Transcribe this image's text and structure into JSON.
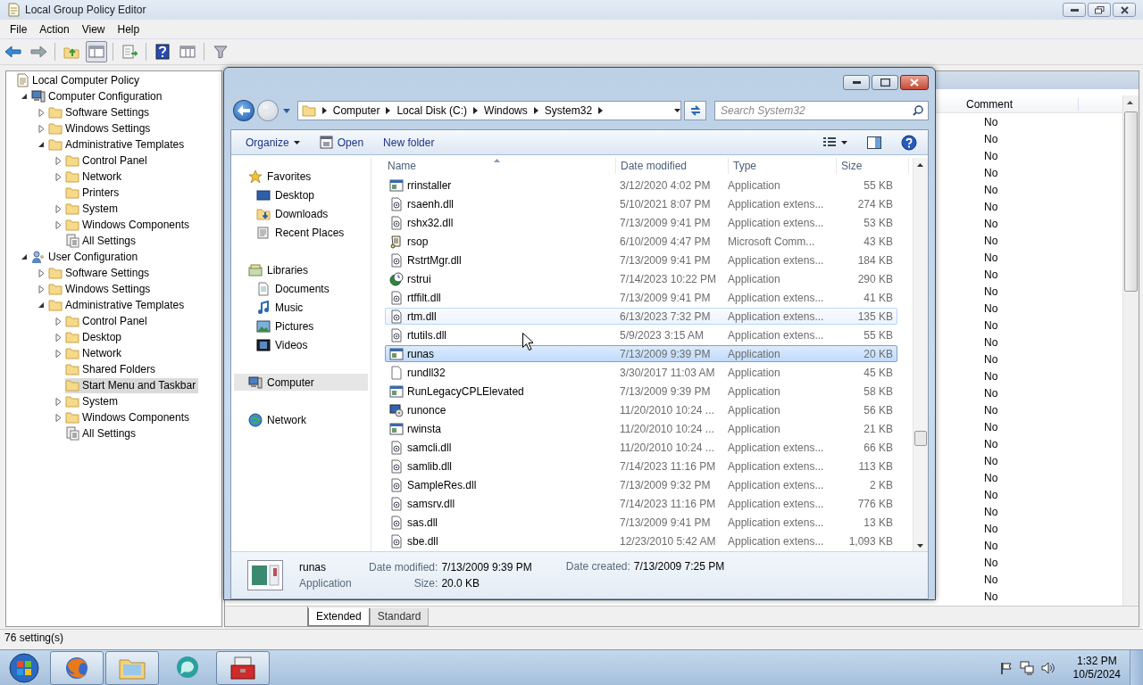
{
  "gpedit": {
    "title": "Local Group Policy Editor",
    "menu": [
      "File",
      "Action",
      "View",
      "Help"
    ],
    "toolbar": [
      {
        "kind": "back",
        "pressed": false
      },
      {
        "kind": "forward",
        "pressed": false
      },
      {
        "kind": "up",
        "pressed": false
      },
      {
        "kind": "tree",
        "pressed": true
      },
      {
        "kind": "export",
        "pressed": false
      },
      {
        "kind": "help",
        "pressed": false
      },
      {
        "kind": "view",
        "pressed": false
      },
      {
        "kind": "filter",
        "pressed": false
      }
    ],
    "tree": [
      {
        "label": "Local Computer Policy",
        "kind": "policy",
        "expandable": false,
        "selected": false,
        "children": [
          {
            "label": "Computer Configuration",
            "kind": "computer",
            "expandable": true,
            "expanded": true,
            "selected": false,
            "children": [
              {
                "label": "Software Settings",
                "kind": "folder",
                "expandable": true,
                "expanded": false,
                "selected": false
              },
              {
                "label": "Windows Settings",
                "kind": "folder",
                "expandable": true,
                "expanded": false,
                "selected": false
              },
              {
                "label": "Administrative Templates",
                "kind": "folder",
                "expandable": true,
                "expanded": true,
                "selected": false,
                "children": [
                  {
                    "label": "Control Panel",
                    "kind": "folder",
                    "expandable": true,
                    "expanded": false,
                    "selected": false
                  },
                  {
                    "label": "Network",
                    "kind": "folder",
                    "expandable": true,
                    "expanded": false,
                    "selected": false
                  },
                  {
                    "label": "Printers",
                    "kind": "folder",
                    "expandable": false,
                    "selected": false
                  },
                  {
                    "label": "System",
                    "kind": "folder",
                    "expandable": true,
                    "expanded": false,
                    "selected": false
                  },
                  {
                    "label": "Windows Components",
                    "kind": "folder",
                    "expandable": true,
                    "expanded": false,
                    "selected": false
                  },
                  {
                    "label": "All Settings",
                    "kind": "settings",
                    "expandable": false,
                    "selected": false
                  }
                ]
              }
            ]
          },
          {
            "label": "User Configuration",
            "kind": "user",
            "expandable": true,
            "expanded": true,
            "selected": false,
            "children": [
              {
                "label": "Software Settings",
                "kind": "folder",
                "expandable": true,
                "expanded": false,
                "selected": false
              },
              {
                "label": "Windows Settings",
                "kind": "folder",
                "expandable": true,
                "expanded": false,
                "selected": false
              },
              {
                "label": "Administrative Templates",
                "kind": "folder",
                "expandable": true,
                "expanded": true,
                "selected": false,
                "children": [
                  {
                    "label": "Control Panel",
                    "kind": "folder",
                    "expandable": true,
                    "expanded": false,
                    "selected": false
                  },
                  {
                    "label": "Desktop",
                    "kind": "folder",
                    "expandable": true,
                    "expanded": false,
                    "selected": false
                  },
                  {
                    "label": "Network",
                    "kind": "folder",
                    "expandable": true,
                    "expanded": false,
                    "selected": false
                  },
                  {
                    "label": "Shared Folders",
                    "kind": "folder",
                    "expandable": false,
                    "selected": false
                  },
                  {
                    "label": "Start Menu and Taskbar",
                    "kind": "folder",
                    "expandable": false,
                    "selected": true
                  },
                  {
                    "label": "System",
                    "kind": "folder",
                    "expandable": true,
                    "expanded": false,
                    "selected": false
                  },
                  {
                    "label": "Windows Components",
                    "kind": "folder",
                    "expandable": true,
                    "expanded": false,
                    "selected": false
                  },
                  {
                    "label": "All Settings",
                    "kind": "settings",
                    "expandable": false,
                    "selected": false
                  }
                ]
              }
            ]
          }
        ]
      }
    ],
    "comment_header": "Comment",
    "comments": [
      "No",
      "No",
      "No",
      "No",
      "No",
      "No",
      "No",
      "No",
      "No",
      "No",
      "No",
      "No",
      "No",
      "No",
      "No",
      "No",
      "No",
      "No",
      "No",
      "No",
      "No",
      "No",
      "No",
      "No",
      "No",
      "No",
      "No",
      "No",
      "No"
    ],
    "view_tabs": [
      {
        "label": "Extended",
        "selected": true
      },
      {
        "label": "Standard",
        "selected": false
      }
    ],
    "status_bar": "76 setting(s)"
  },
  "explorer": {
    "breadcrumb": [
      "Computer",
      "Local Disk (C:)",
      "Windows",
      "System32"
    ],
    "search": {
      "placeholder": "Search System32"
    },
    "commands": [
      {
        "kind": "menu",
        "label": "Organize"
      },
      {
        "kind": "open",
        "label": "Open"
      },
      {
        "kind": "plain",
        "label": "New folder"
      }
    ],
    "nav": [
      {
        "label": "Favorites",
        "kind": "favorites",
        "selected": false,
        "children": [
          {
            "label": "Desktop",
            "kind": "desktop",
            "selected": false
          },
          {
            "label": "Downloads",
            "kind": "downloads",
            "selected": false
          },
          {
            "label": "Recent Places",
            "kind": "recent",
            "selected": false
          }
        ]
      },
      {
        "label": "Libraries",
        "kind": "libraries",
        "selected": false,
        "children": [
          {
            "label": "Documents",
            "kind": "documents",
            "selected": false
          },
          {
            "label": "Music",
            "kind": "music",
            "selected": false
          },
          {
            "label": "Pictures",
            "kind": "pictures",
            "selected": false
          },
          {
            "label": "Videos",
            "kind": "videos",
            "selected": false
          }
        ]
      },
      {
        "label": "Computer",
        "kind": "computer",
        "selected": true
      },
      {
        "label": "Network",
        "kind": "network",
        "selected": false
      }
    ],
    "columns": [
      "Name",
      "Date modified",
      "Type",
      "Size"
    ],
    "files": [
      {
        "name": "rrinstaller",
        "date": "3/12/2020 4:02 PM",
        "type": "Application",
        "size": "55 KB",
        "kind": "app",
        "selected": false,
        "hovered": false
      },
      {
        "name": "rsaenh.dll",
        "date": "5/10/2021 8:07 PM",
        "type": "Application extens...",
        "size": "274 KB",
        "kind": "dll",
        "selected": false,
        "hovered": false
      },
      {
        "name": "rshx32.dll",
        "date": "7/13/2009 9:41 PM",
        "type": "Application extens...",
        "size": "53 KB",
        "kind": "dll",
        "selected": false,
        "hovered": false
      },
      {
        "name": "rsop",
        "date": "6/10/2009 4:47 PM",
        "type": "Microsoft Comm...",
        "size": "43 KB",
        "kind": "script",
        "selected": false,
        "hovered": false
      },
      {
        "name": "RstrtMgr.dll",
        "date": "7/13/2009 9:41 PM",
        "type": "Application extens...",
        "size": "184 KB",
        "kind": "dll",
        "selected": false,
        "hovered": false
      },
      {
        "name": "rstrui",
        "date": "7/14/2023 10:22 PM",
        "type": "Application",
        "size": "290 KB",
        "kind": "restore",
        "selected": false,
        "hovered": false
      },
      {
        "name": "rtffilt.dll",
        "date": "7/13/2009 9:41 PM",
        "type": "Application extens...",
        "size": "41 KB",
        "kind": "dll",
        "selected": false,
        "hovered": false
      },
      {
        "name": "rtm.dll",
        "date": "6/13/2023 7:32 PM",
        "type": "Application extens...",
        "size": "135 KB",
        "kind": "dll",
        "selected": false,
        "hovered": true
      },
      {
        "name": "rtutils.dll",
        "date": "5/9/2023 3:15 AM",
        "type": "Application extens...",
        "size": "55 KB",
        "kind": "dll",
        "selected": false,
        "hovered": false
      },
      {
        "name": "runas",
        "date": "7/13/2009 9:39 PM",
        "type": "Application",
        "size": "20 KB",
        "kind": "app",
        "selected": true,
        "hovered": false
      },
      {
        "name": "rundll32",
        "date": "3/30/2017 11:03 AM",
        "type": "Application",
        "size": "45 KB",
        "kind": "blank",
        "selected": false,
        "hovered": false
      },
      {
        "name": "RunLegacyCPLElevated",
        "date": "7/13/2009 9:39 PM",
        "type": "Application",
        "size": "58 KB",
        "kind": "app",
        "selected": false,
        "hovered": false
      },
      {
        "name": "runonce",
        "date": "11/20/2010 10:24 ...",
        "type": "Application",
        "size": "56 KB",
        "kind": "setup",
        "selected": false,
        "hovered": false
      },
      {
        "name": "rwinsta",
        "date": "11/20/2010 10:24 ...",
        "type": "Application",
        "size": "21 KB",
        "kind": "app",
        "selected": false,
        "hovered": false
      },
      {
        "name": "samcli.dll",
        "date": "11/20/2010 10:24 ...",
        "type": "Application extens...",
        "size": "66 KB",
        "kind": "dll",
        "selected": false,
        "hovered": false
      },
      {
        "name": "samlib.dll",
        "date": "7/14/2023 11:16 PM",
        "type": "Application extens...",
        "size": "113 KB",
        "kind": "dll",
        "selected": false,
        "hovered": false
      },
      {
        "name": "SampleRes.dll",
        "date": "7/13/2009 9:32 PM",
        "type": "Application extens...",
        "size": "2 KB",
        "kind": "dll",
        "selected": false,
        "hovered": false
      },
      {
        "name": "samsrv.dll",
        "date": "7/14/2023 11:16 PM",
        "type": "Application extens...",
        "size": "776 KB",
        "kind": "dll",
        "selected": false,
        "hovered": false
      },
      {
        "name": "sas.dll",
        "date": "7/13/2009 9:41 PM",
        "type": "Application extens...",
        "size": "13 KB",
        "kind": "dll",
        "selected": false,
        "hovered": false
      },
      {
        "name": "sbe.dll",
        "date": "12/23/2010 5:42 AM",
        "type": "Application extens...",
        "size": "1,093 KB",
        "kind": "dll",
        "selected": false,
        "hovered": false
      }
    ],
    "details": {
      "name": "runas",
      "type": "Application",
      "modified_label": "Date modified:",
      "modified": "7/13/2009 9:39 PM",
      "created_label": "Date created:",
      "created": "7/13/2009 7:25 PM",
      "size_label": "Size:",
      "size": "20.0 KB"
    }
  },
  "taskbar": {
    "apps": [
      {
        "kind": "browser",
        "running": true
      },
      {
        "kind": "explorer",
        "running": true
      },
      {
        "kind": "chat",
        "running": false
      },
      {
        "kind": "toolbox",
        "running": true
      }
    ],
    "time": "1:32 PM",
    "date": "10/5/2024"
  }
}
